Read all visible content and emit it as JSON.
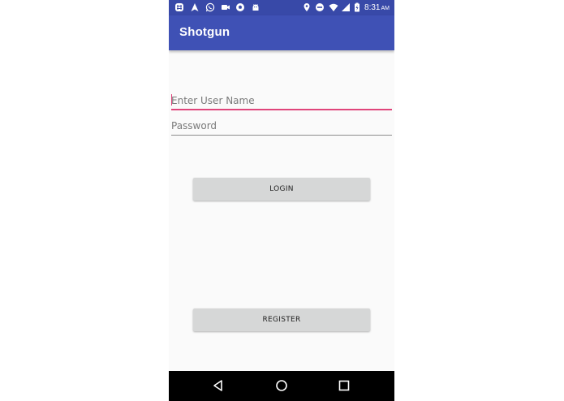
{
  "status_bar": {
    "time": "8:31",
    "ampm": "AM",
    "left_icons": [
      "slack-icon",
      "navigation-icon",
      "whatsapp-icon",
      "facetime-icon",
      "soccer-ball-icon",
      "android-icon"
    ],
    "right_icons": [
      "location-icon",
      "do-not-disturb-icon",
      "wifi-icon",
      "signal-icon",
      "battery-charging-icon"
    ]
  },
  "app_bar": {
    "title": "Shotgun"
  },
  "form": {
    "username": {
      "placeholder": "Enter User Name",
      "value": ""
    },
    "password": {
      "placeholder": "Password",
      "value": ""
    },
    "login_label": "LOGIN",
    "register_label": "REGISTER"
  },
  "nav_bar": {
    "buttons": [
      "back-icon",
      "home-icon",
      "recents-icon"
    ]
  },
  "colors": {
    "status_bar": "#3849a8",
    "primary": "#3f51b5",
    "accent": "#e0457b",
    "background": "#fafafa",
    "button": "#d6d7d7"
  }
}
